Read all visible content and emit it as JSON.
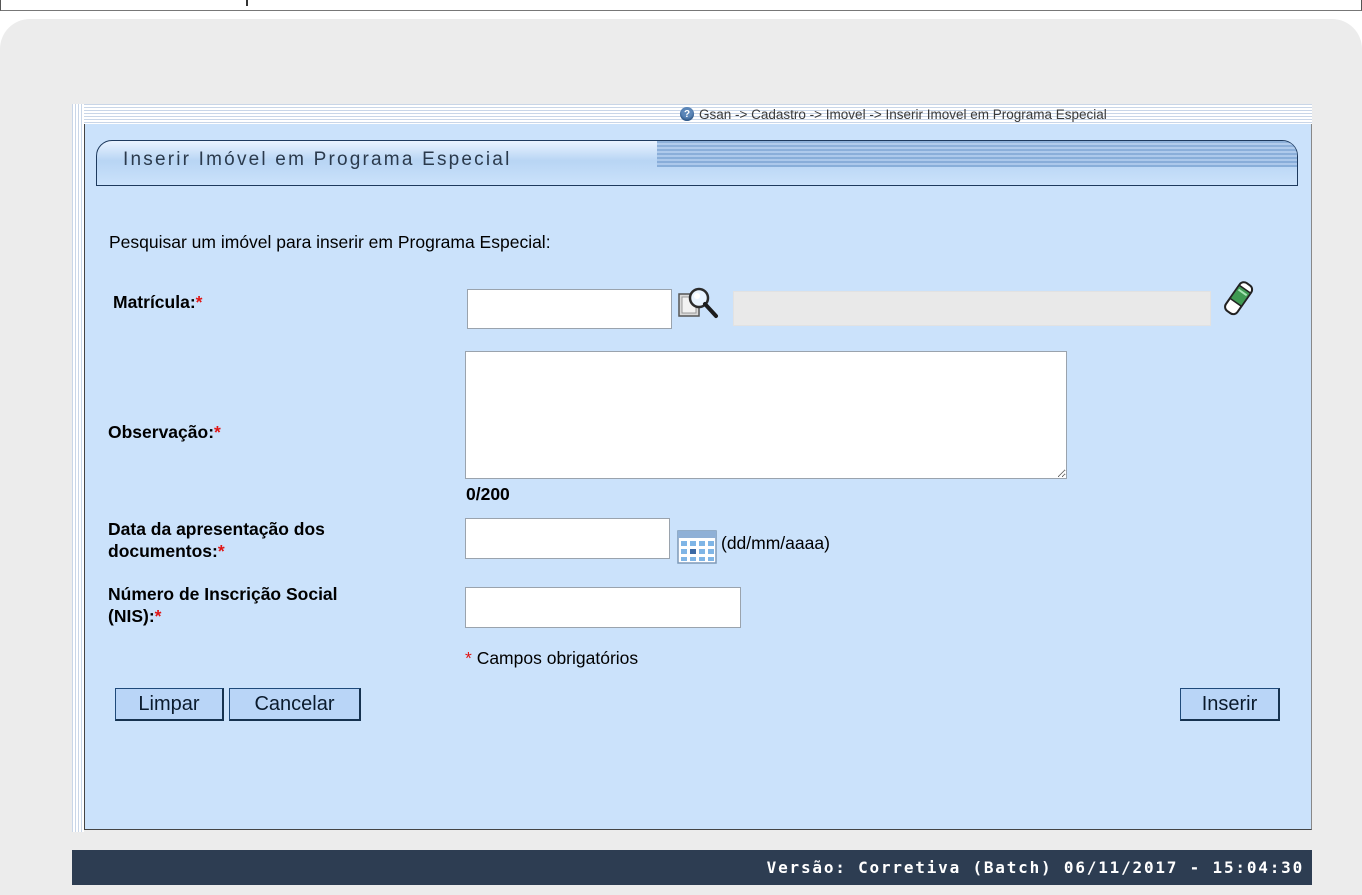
{
  "breadcrumb": "Gsan -> Cadastro -> Imovel -> Inserir Imovel em Programa Especial",
  "title": "Inserir Imóvel em Programa Especial",
  "instruction": "Pesquisar um imóvel para inserir em Programa Especial:",
  "required_mark": "*",
  "form": {
    "matricula_label": "Matrícula:",
    "matricula_value": "",
    "observacao_label": "Observação:",
    "observacao_value": "",
    "counter": "0/200",
    "data_label_line1": "Data da apresentação dos",
    "data_label_line2": "documentos:",
    "data_value": "",
    "date_format_hint": "(dd/mm/aaaa)",
    "nis_label_line1": "Número de Inscrição Social",
    "nis_label_line2": "(NIS):",
    "nis_value": "",
    "required_note": "Campos obrigatórios"
  },
  "buttons": {
    "limpar": "Limpar",
    "cancelar": "Cancelar",
    "inserir": "Inserir"
  },
  "footer": "Versão: Corretiva (Batch) 06/11/2017 - 15:04:30",
  "icons": {
    "help": "help-icon",
    "search": "magnifier-icon",
    "clear": "eraser-icon",
    "calendar": "calendar-icon"
  },
  "colors": {
    "panel": "#cbe2fb",
    "footer": "#2d3d52",
    "required": "#e01515",
    "button": "#b9d5f7"
  }
}
